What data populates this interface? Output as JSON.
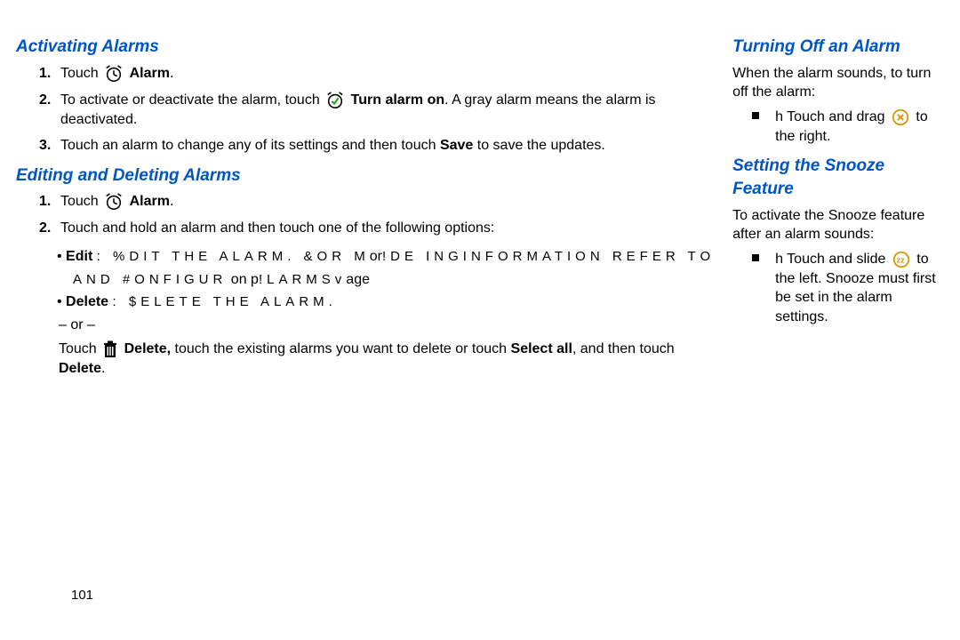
{
  "left": {
    "h1": "Activating Alarms",
    "act1_touch": "Touch",
    "act1_alarm": "Alarm",
    "act2_a": "To activate or deactivate the alarm, touch",
    "act2_turn": "Turn",
    "act2_b": "alarm on",
    "act2_c": ". A gray alarm means the alarm is deactivated.",
    "act3": "Touch an alarm to change any of its settings and then touch ",
    "act3_save": "Save",
    "act3_b": " to save the updates.",
    "h2": "Editing and Deleting Alarms",
    "ed1_touch": "Touch",
    "ed1_alarm": "Alarm",
    "ed2": "Touch and hold an alarm and then touch one of the following options:",
    "edit_label": "Edit",
    "edit_garble_a": ": %DIT THE ALARM. &OR M",
    "edit_garble_mid1": "or",
    "edit_garble_b": "!DE ING",
    "edit_garble_mid2": "\"",
    "edit_garble_c": "INFORMATION REFER TO",
    "edit_garble_d": "AND #ONFIGUR",
    "edit_garble_e": " on p",
    "edit_garble_f": "!LARMSv",
    "edit_garble_g": "age",
    "edit_garble_h": "",
    "delete_label": "Delete",
    "delete_garble": ": $ELETE THE ALARM.",
    "or": "– or –",
    "del_touch": "Touch",
    "del_delete_b": "Delete,",
    "del_tail_a": " touch the existing alarms you want to delete or touch ",
    "del_selectall": "Select all",
    "del_tail_b": ", and then touch ",
    "del_delete_b2": "Delete",
    "period": "."
  },
  "right": {
    "h3": "Turning Off an Alarm",
    "off_intro": "When the alarm sounds, to turn off the alarm:",
    "off_bullet_a": "h Touch and drag",
    "off_bullet_b": "to the right.",
    "h4": "Setting the Snooze Feature",
    "sn_intro": "To activate the Snooze feature after an alarm sounds:",
    "sn_bullet_a": "h Touch and slide",
    "sn_bullet_b": "to the left. Snooze must first be set in the alarm settings."
  },
  "pagenum": "101",
  "nums": {
    "n1": "1.",
    "n2": "2.",
    "n3": "3."
  }
}
